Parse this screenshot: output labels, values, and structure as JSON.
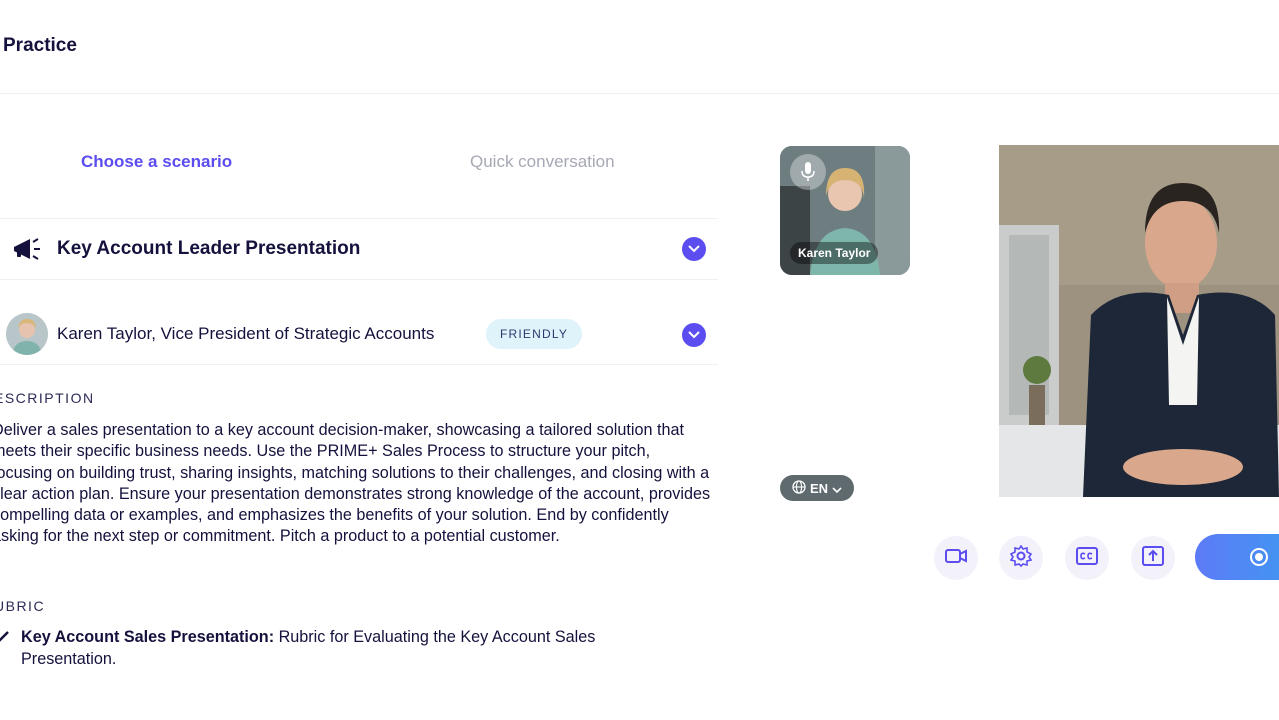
{
  "header": {
    "title": "Practice"
  },
  "tabs": [
    {
      "label": "Choose a scenario",
      "active": true
    },
    {
      "label": "Quick conversation",
      "active": false
    }
  ],
  "scenario": {
    "title": "Key Account Leader Presentation",
    "icon": "megaphone-icon"
  },
  "persona": {
    "name": "Karen Taylor, Vice President of Strategic Accounts",
    "mood": "FRIENDLY"
  },
  "description": {
    "label": "ESCRIPTION",
    "text": "Deliver a sales presentation to a key account decision-maker, showcasing a tailored solution that meets their specific business needs. Use the PRIME+ Sales Process to structure your pitch, focusing on building trust, sharing insights, matching solutions to their challenges, and closing with a clear action plan. Ensure your presentation demonstrates strong knowledge of the account, provides compelling data or examples, and emphasizes the benefits of your solution. End by confidently asking for the next step or commitment. Pitch a product to a potential customer."
  },
  "rubric": {
    "label": "UBRIC",
    "items": [
      {
        "title": "Key Account Sales Presentation:",
        "text": " Rubric for Evaluating the Key Account Sales Presentation."
      }
    ]
  },
  "video": {
    "self_name": "Karen Taylor",
    "language": "EN"
  },
  "controls": [
    "camera-icon",
    "settings-icon",
    "captions-icon",
    "share-screen-icon",
    "record-icon"
  ],
  "colors": {
    "accent": "#5b4df0",
    "badge_bg": "#dff3fb",
    "start_gradient": [
      "#5d7bf7",
      "#3a9cf0"
    ]
  }
}
